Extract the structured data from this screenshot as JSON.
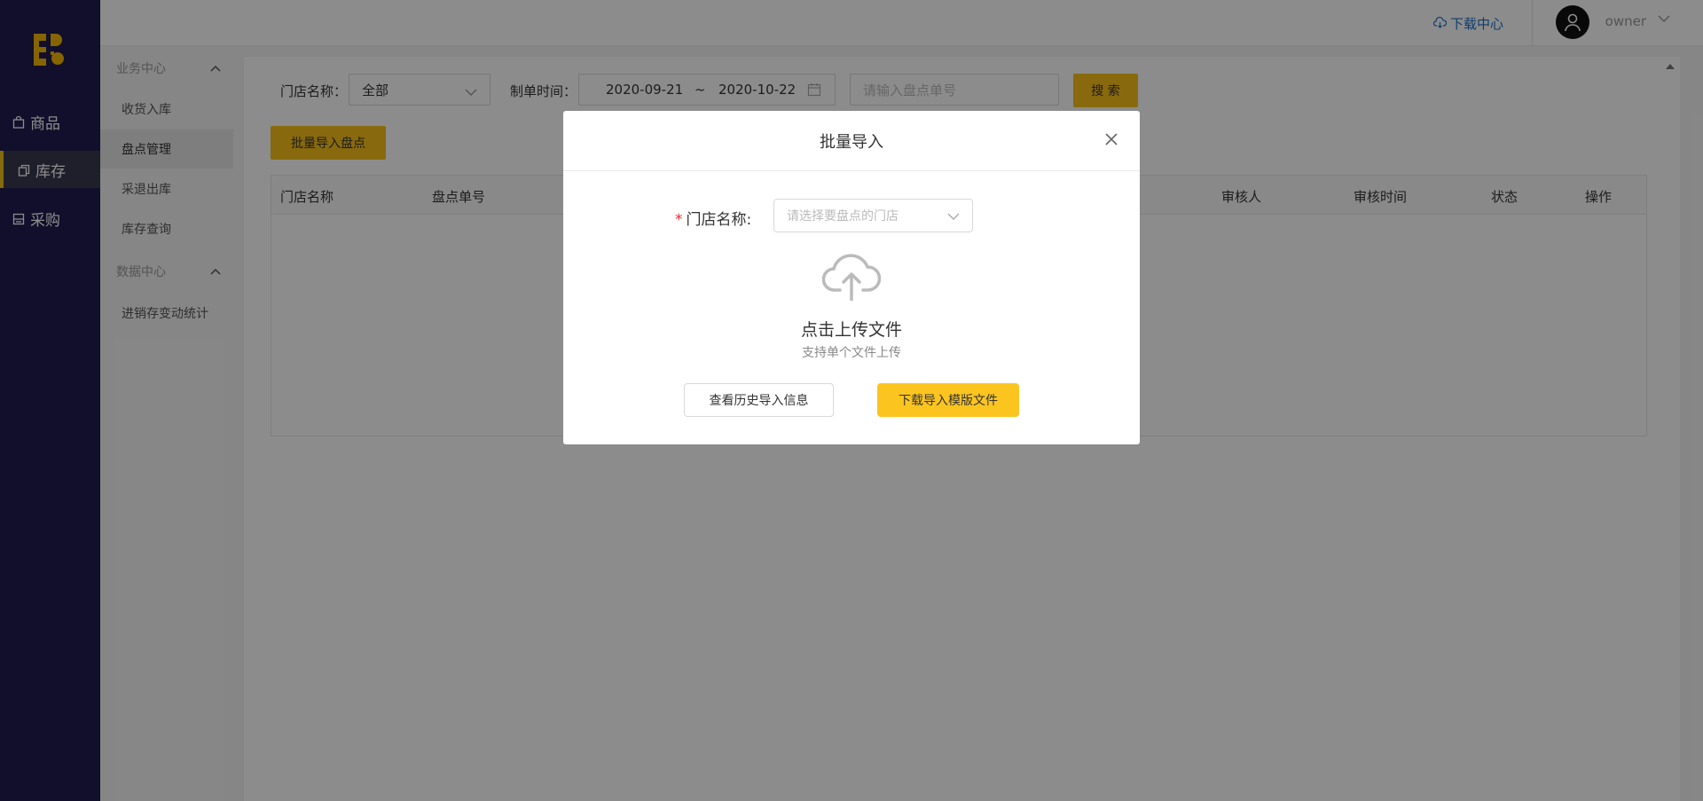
{
  "colors": {
    "rail_bg": "#1f1d4f",
    "accent": "#f8c018",
    "link": "#1e6fc7"
  },
  "rail": {
    "items": [
      {
        "label": "商品",
        "icon": "bag-icon"
      },
      {
        "label": "库存",
        "icon": "copy-icon",
        "active": true
      },
      {
        "label": "采购",
        "icon": "cart-icon"
      }
    ]
  },
  "submenu": {
    "group1": "业务中心",
    "items1": [
      "收货入库",
      "盘点管理",
      "采退出库",
      "库存查询"
    ],
    "group2": "数据中心",
    "items2": [
      "进销存变动统计"
    ]
  },
  "topbar": {
    "download_center": "下载中心",
    "username": "owner"
  },
  "filters": {
    "store_label": "门店名称：",
    "store_value": "全部",
    "date_label": "制单时间：",
    "date_start": "2020-09-21",
    "date_sep": "~",
    "date_end": "2020-10-22",
    "order_placeholder": "请输入盘点单号",
    "search_button": "搜 索"
  },
  "batch_button": "批量导入盘点",
  "table": {
    "columns": [
      "门店名称",
      "盘点单号",
      "审核人",
      "审核时间",
      "状态",
      "操作"
    ]
  },
  "modal": {
    "title": "批量导入",
    "required_mark": "*",
    "store_label": "门店名称:",
    "store_placeholder": "请选择要盘点的门店",
    "upload_title": "点击上传文件",
    "upload_sub": "支持单个文件上传",
    "history_button": "查看历史导入信息",
    "download_button": "下载导入模版文件"
  }
}
